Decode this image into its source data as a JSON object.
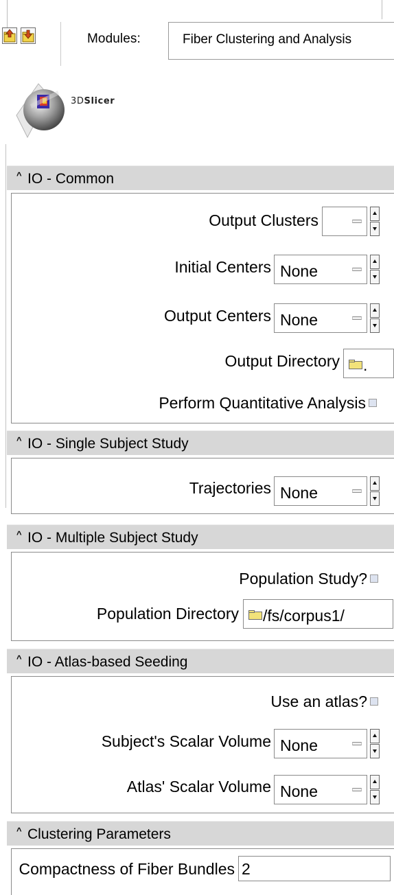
{
  "toolbar": {
    "modules_label": "Modules:",
    "modules_value": "Fiber Clustering and Analysis",
    "logo_text_prefix": "3D",
    "logo_text_suffix": "Slicer"
  },
  "icons": {
    "prev_module": "up-arrow-folder-icon",
    "next_module": "down-arrow-folder-icon",
    "logo": "slicer-logo-icon",
    "folder": "folder-icon",
    "collapse": "caret-up-icon"
  },
  "sections": {
    "common": {
      "caret": "^",
      "title": "IO - Common",
      "output_clusters": {
        "label": "Output Clusters",
        "value": ""
      },
      "initial_centers": {
        "label": "Initial Centers",
        "value": "None"
      },
      "output_centers": {
        "label": "Output Centers",
        "value": "None"
      },
      "output_directory": {
        "label": "Output Directory",
        "value": "."
      },
      "quant_analysis": {
        "label": "Perform Quantitative Analysis",
        "checked": false
      }
    },
    "single": {
      "caret": "^",
      "title": "IO - Single Subject Study",
      "trajectories": {
        "label": "Trajectories",
        "value": "None"
      }
    },
    "multiple": {
      "caret": "^",
      "title": "IO - Multiple Subject Study",
      "population_study": {
        "label": "Population Study?",
        "checked": false
      },
      "population_directory": {
        "label": "Population Directory",
        "value": "/fs/corpus1/"
      }
    },
    "atlas": {
      "caret": "^",
      "title": "IO - Atlas-based Seeding",
      "use_atlas": {
        "label": "Use an atlas?",
        "checked": false
      },
      "subject_scalar": {
        "label": "Subject's Scalar Volume",
        "value": "None"
      },
      "atlas_scalar": {
        "label": "Atlas' Scalar Volume",
        "value": "None"
      }
    },
    "clustering": {
      "caret": "^",
      "title": "Clustering Parameters",
      "compactness": {
        "label": "Compactness of Fiber Bundles",
        "value": "2"
      }
    }
  },
  "colors": {
    "section_header_bg": "#d7d7d7",
    "checkbox_fill": "#dde3f0",
    "folder_yellow": "#f2e27a"
  }
}
